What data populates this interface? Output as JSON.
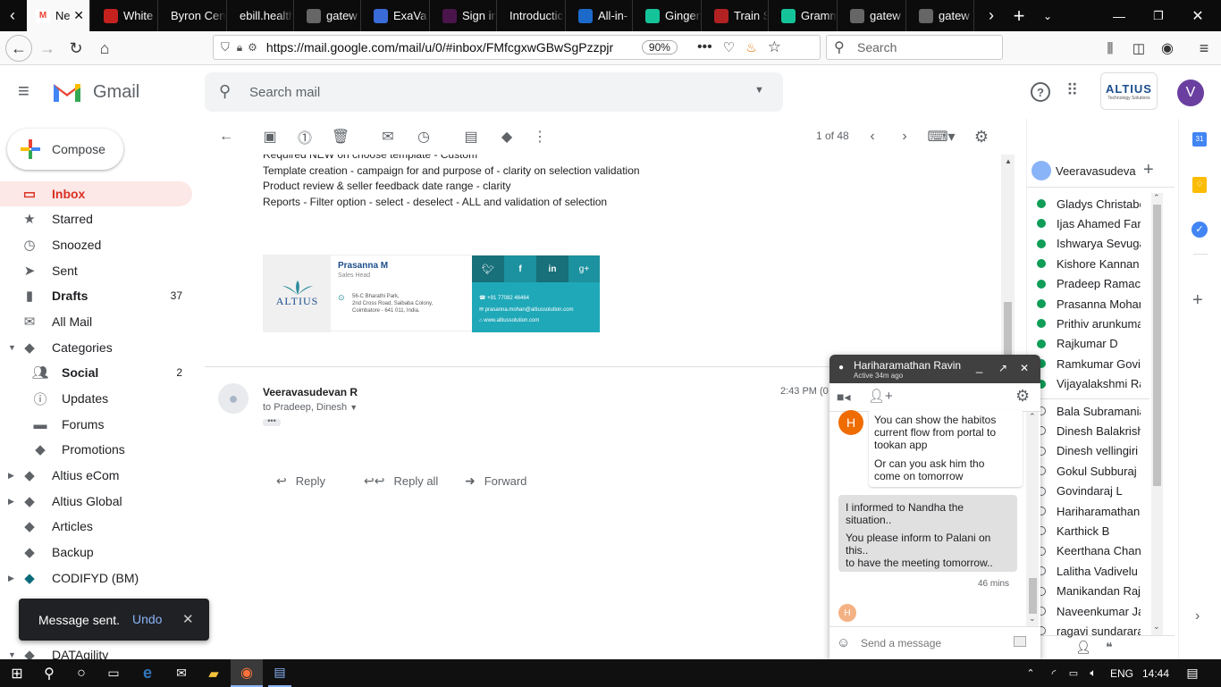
{
  "browser": {
    "tabs": [
      {
        "label": "Ne",
        "icon": "gmail-icon",
        "active": true
      },
      {
        "label": "White",
        "icon": "doc-icon"
      },
      {
        "label": "Byron Cen",
        "icon": ""
      },
      {
        "label": "ebill.health",
        "icon": ""
      },
      {
        "label": "gatew",
        "icon": "github-icon"
      },
      {
        "label": "ExaVa",
        "icon": "exa-icon"
      },
      {
        "label": "Sign in",
        "icon": "slack-icon"
      },
      {
        "label": "Introductic",
        "icon": ""
      },
      {
        "label": "All-in-",
        "icon": "aio-icon"
      },
      {
        "label": "Ginger",
        "icon": "grammarly-icon"
      },
      {
        "label": "Train S",
        "icon": "train-icon"
      },
      {
        "label": "Gramm",
        "icon": "grammarly-icon"
      },
      {
        "label": "gatew",
        "icon": "github-icon"
      },
      {
        "label": "gatew",
        "icon": "github-icon"
      }
    ],
    "url": "https://mail.google.com/mail/u/0/#inbox/FMfcgxwGBwSgPzzpjr",
    "zoom": "90%",
    "search_placeholder": "Search"
  },
  "gmail": {
    "brand": "Gmail",
    "search_placeholder": "Search mail",
    "avatar_letter": "V",
    "org_logo": "ALTIUS",
    "org_tagline": "Technology Solutions"
  },
  "compose_label": "Compose",
  "nav": [
    {
      "label": "Inbox",
      "count": "",
      "icon": "inbox-icon",
      "active": true
    },
    {
      "label": "Starred",
      "count": "",
      "icon": "star-icon"
    },
    {
      "label": "Snoozed",
      "count": "",
      "icon": "clock-icon"
    },
    {
      "label": "Sent",
      "count": "",
      "icon": "send-icon"
    },
    {
      "label": "Drafts",
      "count": "37",
      "icon": "draft-icon",
      "bold": true
    },
    {
      "label": "All Mail",
      "count": "",
      "icon": "mail-icon"
    },
    {
      "label": "Categories",
      "count": "",
      "icon": "label-icon"
    },
    {
      "label": "Social",
      "count": "2",
      "icon": "people-icon",
      "bold": true
    },
    {
      "label": "Updates",
      "count": "",
      "icon": "info-icon"
    },
    {
      "label": "Forums",
      "count": "",
      "icon": "forum-icon"
    },
    {
      "label": "Promotions",
      "count": "",
      "icon": "tag-icon"
    },
    {
      "label": "Altius eCom",
      "count": "",
      "icon": "label-icon"
    },
    {
      "label": "Altius Global",
      "count": "",
      "icon": "label-icon"
    },
    {
      "label": "Articles",
      "count": "",
      "icon": "label-icon"
    },
    {
      "label": "Backup",
      "count": "",
      "icon": "label-icon"
    },
    {
      "label": "CODIFYD (BM)",
      "count": "",
      "icon": "label-icon"
    },
    {
      "label": "DATAgility",
      "count": "",
      "icon": "label-icon"
    }
  ],
  "toolbar": {
    "pager": "1 of 48"
  },
  "email": {
    "lines": [
      "Required NEW on choose template - Custom",
      "Template creation - campaign for and purpose of - clarity on selection validation",
      "Product review & seller feedback date range - clarity",
      "Reports - Filter option - select - deselect - ALL and validation of selection"
    ],
    "signature": {
      "name": "Prasanna M",
      "title": "Sales Head",
      "address": [
        "56-C Bharathi Park,",
        "2nd Cross Road, Saibaba Colony,",
        "Coimbatore - 641 011, India."
      ],
      "phone": "+91 77082 46464",
      "email": "prasanna.mohan@altiussolution.com",
      "web": "www.altiussolution.com",
      "logo": "ALTIUS"
    },
    "reply": {
      "sender": "Veeravasudevan R",
      "to": "to Pradeep, Dinesh",
      "time": "2:43 PM (0"
    },
    "actions": [
      "Reply",
      "Reply all",
      "Forward"
    ]
  },
  "contacts": {
    "me": "Veeravasudeva",
    "list": [
      {
        "name": "Gladys Christabe",
        "online": true
      },
      {
        "name": "Ijas Ahamed Faro",
        "online": true
      },
      {
        "name": "Ishwarya Sevuga",
        "online": true
      },
      {
        "name": "Kishore Kannan",
        "online": true
      },
      {
        "name": "Pradeep Ramach",
        "online": true
      },
      {
        "name": "Prasanna Mohan",
        "online": true
      },
      {
        "name": "Prithiv arunkuma",
        "online": true
      },
      {
        "name": "Rajkumar D",
        "online": true
      },
      {
        "name": "Ramkumar Govir",
        "online": true
      },
      {
        "name": "Vijayalakshmi Ra",
        "online": true
      },
      {
        "name": "Bala Subramania",
        "online": false
      },
      {
        "name": "Dinesh Balakrish",
        "online": false
      },
      {
        "name": "Dinesh vellingiri",
        "online": false
      },
      {
        "name": "Gokul Subburaj",
        "online": false
      },
      {
        "name": "Govindaraj L",
        "online": false
      },
      {
        "name": "Hariharamathan",
        "online": false
      },
      {
        "name": "Karthick B",
        "online": false
      },
      {
        "name": "Keerthana Chanc",
        "online": false
      },
      {
        "name": "Lalitha Vadivelu",
        "online": false
      },
      {
        "name": "Manikandan Raja",
        "online": false
      },
      {
        "name": "Naveenkumar Ja",
        "online": false
      },
      {
        "name": "ragavi sundarara",
        "online": false
      }
    ]
  },
  "chat": {
    "name": "Hariharamathan Ravin",
    "status": "Active 34m ago",
    "avatar_letter": "H",
    "incoming": [
      "You can show the habitos current flow from portal to tookan app",
      "Or can you ask him tho come on tomorrow"
    ],
    "outgoing": [
      "I informed to Nandha the situation..",
      "You please inform to Palani on this..",
      "to have the meeting tomorrow.."
    ],
    "time": "46 mins",
    "input_placeholder": "Send a message"
  },
  "toast": {
    "message": "Message sent.",
    "undo": "Undo"
  },
  "taskbar": {
    "lang": "ENG",
    "time": "14:44"
  },
  "colors": {
    "gmail_red": "#d93025",
    "online": "#0f9d58",
    "signature_teal": "#1fa8b8",
    "link_blue": "#8ab4f8"
  }
}
